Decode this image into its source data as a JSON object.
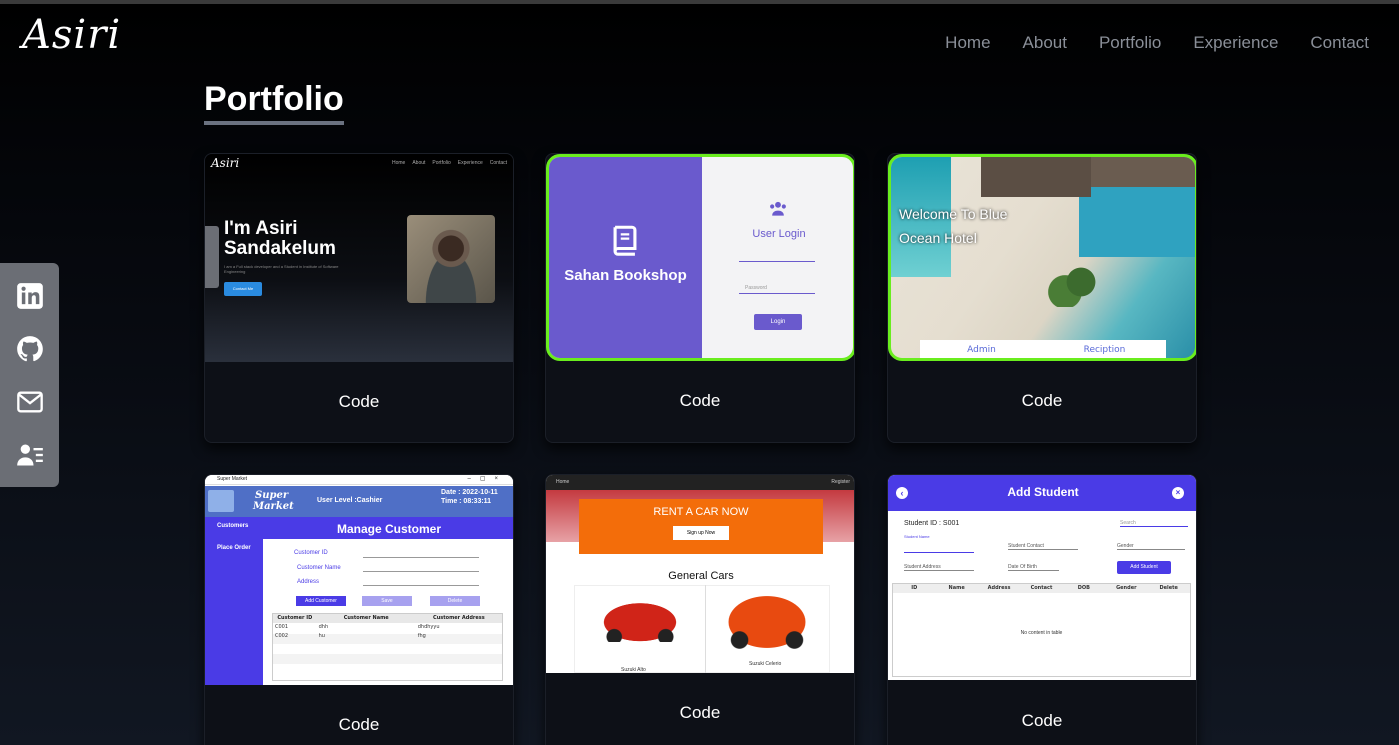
{
  "header": {
    "logo": "Asiri",
    "nav": [
      "Home",
      "About",
      "Portfolio",
      "Experience",
      "Contact"
    ]
  },
  "section": {
    "title": "Portfolio"
  },
  "social": {
    "icons": [
      "linkedin-icon",
      "github-icon",
      "mail-icon",
      "contact-card-icon"
    ]
  },
  "colors": {
    "accent_green": "#6aed1e",
    "purple": "#6a5acd",
    "orange": "#f36d0a",
    "blue": "#4a3be6"
  },
  "projects": [
    {
      "code_label": "Code",
      "shot": {
        "logo": "Asiri",
        "nav": [
          "Home",
          "About",
          "Portfolio",
          "Experience",
          "Contact"
        ],
        "line1": "I'm Asiri",
        "line2": "Sandakelum",
        "sub": "I am a Full stack developer and a Student in Institute of Software Engineering",
        "button": "Contact Me"
      }
    },
    {
      "code_label": "Code",
      "shot": {
        "brand": "Sahan Bookshop",
        "title": "User Login",
        "password_placeholder": "Password",
        "button": "Login"
      }
    },
    {
      "code_label": "Code",
      "shot": {
        "welcome_line1": "Welcome To Blue",
        "welcome_line2": "Ocean Hotel",
        "tabs": [
          "Admin",
          "Reciption"
        ]
      }
    },
    {
      "code_label": "Code",
      "shot": {
        "window_title": "Super Market",
        "brand_line1": "Super",
        "brand_line2": "Market",
        "user_level": "User Level :Cashier",
        "date": "Date  :  2022-10-11",
        "time": "Time  :  08:33:11",
        "menu": [
          "Customers",
          "Place Order"
        ],
        "title": "Manage Customer",
        "fields": [
          "Customer ID",
          "Customer Name",
          "Address"
        ],
        "buttons": [
          "Add Customer",
          "Save",
          "Delete"
        ],
        "columns": [
          "Customer ID",
          "Customer Name",
          "Customer Address"
        ],
        "rows": [
          [
            "C001",
            "dhh",
            "dhdhyyu"
          ],
          [
            "C002",
            "hu",
            "fhg"
          ]
        ]
      }
    },
    {
      "code_label": "Code",
      "shot": {
        "nav_left": "Home",
        "nav_right": "Register",
        "banner": "RENT A CAR NOW",
        "button": "Sign up Now",
        "section": "General Cars",
        "cars": [
          "Suzuki Alto",
          "Suzuki Celerio"
        ]
      }
    },
    {
      "code_label": "Code",
      "shot": {
        "title": "Add Student",
        "student_id": "Student ID :  S001",
        "search_placeholder": "Search",
        "student_name_label": "Student Name",
        "contact_placeholder": "Student Contact",
        "gender_placeholder": "Gender",
        "address_placeholder": "Student Address",
        "dob_placeholder": "Date Of Birth",
        "button": "Add Student",
        "columns": [
          "ID",
          "Name",
          "Address",
          "Contact",
          "DOB",
          "Gender",
          "Delete"
        ],
        "empty": "No content in table"
      }
    }
  ]
}
